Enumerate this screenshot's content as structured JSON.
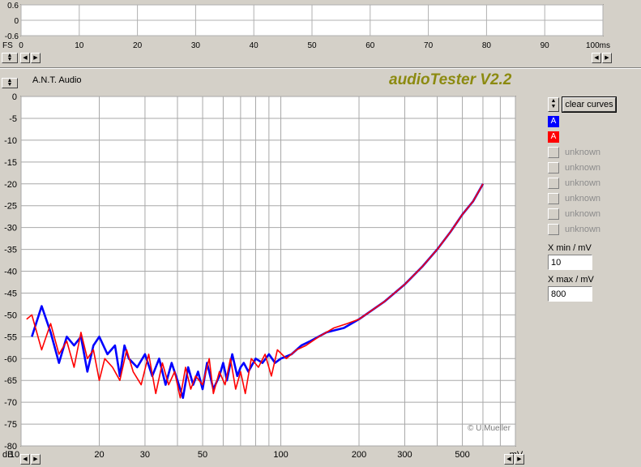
{
  "app_title": "audioTester V2.2",
  "brand": "A.N.T. Audio",
  "copyright": "© U.Mueller",
  "top_scope": {
    "y_ticks": [
      "0.6",
      "0",
      "-0.6"
    ],
    "x_prefix": "FS",
    "x_ticks": [
      "0",
      "10",
      "20",
      "30",
      "40",
      "50",
      "60",
      "70",
      "80",
      "90",
      "100ms"
    ]
  },
  "controls": {
    "clear_curves_label": "clear curves",
    "channels": [
      {
        "label": "A",
        "color": "#0000ff",
        "active": true
      },
      {
        "label": "A",
        "color": "#ff0000",
        "active": true
      },
      {
        "label": "unknown",
        "active": false
      },
      {
        "label": "unknown",
        "active": false
      },
      {
        "label": "unknown",
        "active": false
      },
      {
        "label": "unknown",
        "active": false
      },
      {
        "label": "unknown",
        "active": false
      },
      {
        "label": "unknown",
        "active": false
      }
    ],
    "xmin_label": "X min / mV",
    "xmin_value": "10",
    "xmax_label": "X max / mV",
    "xmax_value": "800"
  },
  "chart_data": {
    "type": "line",
    "x_scale": "log",
    "xlim": [
      10,
      800
    ],
    "ylim": [
      -80,
      0
    ],
    "grid": true,
    "xlabel": "mV",
    "ylabel": "dB",
    "x_tick_labels": [
      "10",
      "20",
      "30",
      "50",
      "100",
      "200",
      "300",
      "500"
    ],
    "y_tick_labels": [
      "0",
      "-5",
      "-10",
      "-15",
      "-20",
      "-25",
      "-30",
      "-35",
      "-40",
      "-45",
      "-50",
      "-55",
      "-60",
      "-65",
      "-70",
      "-75",
      "-80"
    ],
    "series": [
      {
        "color": "#0000ff",
        "x": [
          11.0,
          12.0,
          13.0,
          14.0,
          15.0,
          16.0,
          17.0,
          18.0,
          19.0,
          20.0,
          21.5,
          23.0,
          24.0,
          25.0,
          26.0,
          28.0,
          30.0,
          32.0,
          34.0,
          36.0,
          38.0,
          40.0,
          42.0,
          44.0,
          46.0,
          48.0,
          50.0,
          52.0,
          55.0,
          58.0,
          60.0,
          62.0,
          65.0,
          68.0,
          70.0,
          72.0,
          75.0,
          80.0,
          85.0,
          90.0,
          95.0,
          100.0,
          110.0,
          120.0,
          130.0,
          150.0,
          175.0,
          200.0,
          250.0,
          300.0,
          350.0,
          400.0,
          450.0,
          500.0,
          550.0,
          600.0
        ],
        "y": [
          -55,
          -48,
          -54,
          -61,
          -55,
          -57,
          -55,
          -63,
          -57,
          -55,
          -59,
          -57,
          -64,
          -57,
          -60,
          -62,
          -59,
          -64,
          -60,
          -66,
          -61,
          -65,
          -69,
          -62,
          -66,
          -63,
          -67,
          -61,
          -67,
          -64,
          -61,
          -65,
          -59,
          -64,
          -62,
          -61,
          -63,
          -60,
          -61,
          -59,
          -61,
          -60,
          -59,
          -57,
          -56,
          -54,
          -53,
          -51,
          -47,
          -43,
          -39,
          -35,
          -31,
          -27,
          -24,
          -20
        ]
      },
      {
        "color": "#ff0000",
        "x": [
          10.5,
          11.0,
          12.0,
          13.0,
          14.0,
          15.0,
          16.0,
          17.0,
          18.0,
          19.0,
          20.0,
          21.0,
          22.5,
          24.0,
          25.5,
          27.0,
          29.0,
          31.0,
          33.0,
          35.0,
          37.0,
          39.0,
          41.0,
          43.0,
          45.0,
          47.0,
          50.0,
          53.0,
          55.0,
          58.0,
          61.0,
          64.0,
          67.0,
          70.0,
          73.0,
          77.0,
          82.0,
          87.0,
          92.0,
          97.0,
          105.0,
          115.0,
          125.0,
          140.0,
          160.0,
          180.0,
          200.0,
          250.0,
          300.0,
          350.0,
          400.0,
          450.0,
          500.0,
          550.0,
          600.0
        ],
        "y": [
          -51,
          -50,
          -58,
          -52,
          -59,
          -56,
          -62,
          -54,
          -60,
          -58,
          -65,
          -60,
          -62,
          -65,
          -58,
          -63,
          -66,
          -59,
          -68,
          -61,
          -66,
          -63,
          -69,
          -62,
          -67,
          -64,
          -66,
          -60,
          -68,
          -63,
          -66,
          -60,
          -67,
          -63,
          -68,
          -60,
          -62,
          -59,
          -64,
          -58,
          -60,
          -58,
          -57,
          -55,
          -53,
          -52,
          -51,
          -47,
          -43,
          -39,
          -35,
          -31,
          -27,
          -24,
          -20
        ]
      }
    ]
  }
}
